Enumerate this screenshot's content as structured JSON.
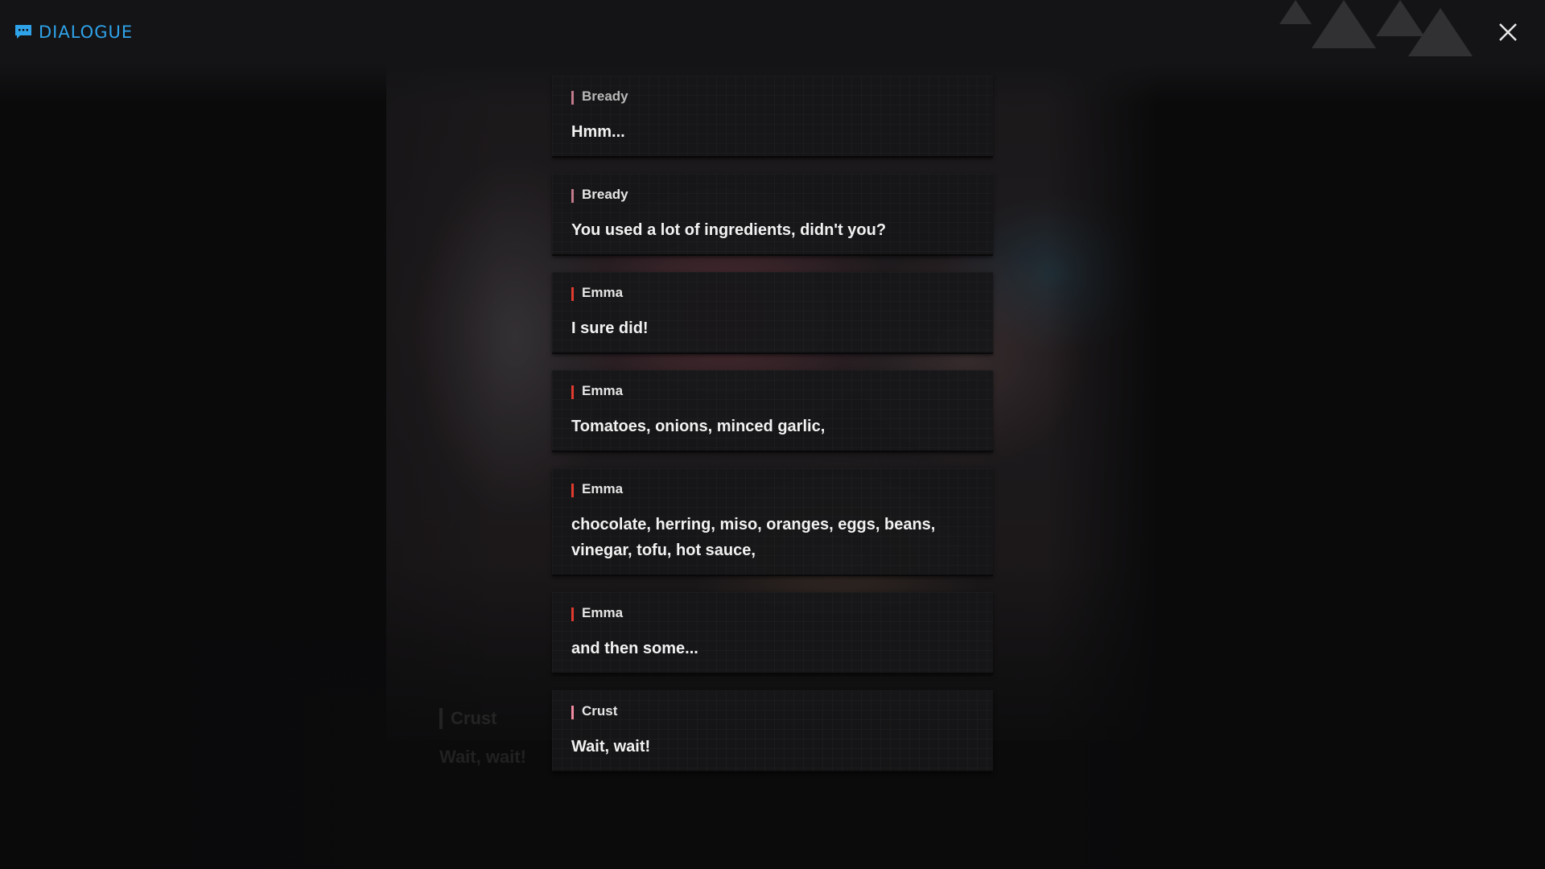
{
  "header": {
    "title": "DIALOGUE",
    "accent": "#2fa3ea",
    "icon": "chat-bubble-icon",
    "close_icon": "close-icon"
  },
  "entries": [
    {
      "speaker": "Bready",
      "text": "Hmm...",
      "speaker_color": "#c07a8a"
    },
    {
      "speaker": "Bready",
      "text": "You used a lot of ingredients, didn't you?",
      "speaker_color": "#c07a8a"
    },
    {
      "speaker": "Emma",
      "text": "I sure did!",
      "speaker_color": "#e03b2f"
    },
    {
      "speaker": "Emma",
      "text": "Tomatoes, onions, minced garlic,",
      "speaker_color": "#e03b2f"
    },
    {
      "speaker": "Emma",
      "text": "chocolate, herring, miso, oranges, eggs, beans, vinegar, tofu, hot sauce,",
      "speaker_color": "#e03b2f"
    },
    {
      "speaker": "Emma",
      "text": "and then some...",
      "speaker_color": "#e03b2f"
    },
    {
      "speaker": "Crust",
      "text": "Wait, wait!",
      "speaker_color": "#f08aa0"
    }
  ],
  "background_caption": {
    "speaker": "Crust",
    "text": "Wait, wait!"
  }
}
